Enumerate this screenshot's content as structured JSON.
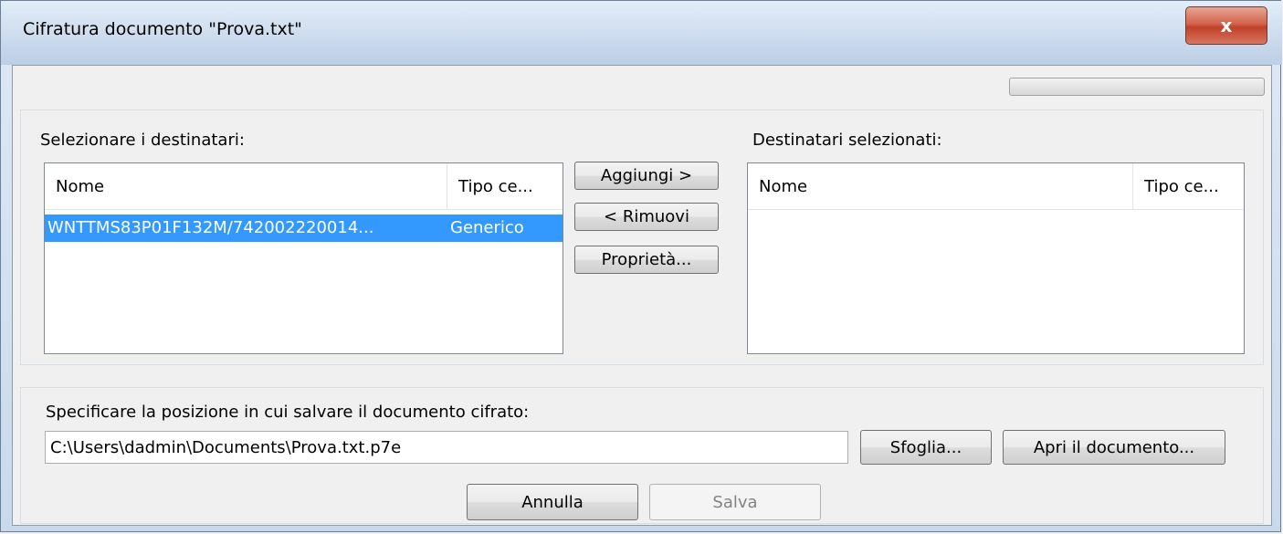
{
  "window": {
    "title": "Cifratura documento \"Prova.txt\"",
    "close_label": "x"
  },
  "recipients": {
    "label": "Selezionare i destinatari:",
    "columns": [
      "Nome",
      "Tipo ce..."
    ],
    "rows": [
      {
        "name": "WNTTMS83P01F132M/742002220014...",
        "type": "Generico",
        "selected": true
      }
    ]
  },
  "selected": {
    "label": "Destinatari selezionati:",
    "columns": [
      "Nome",
      "Tipo ce..."
    ]
  },
  "actions": {
    "add": "Aggiungi >",
    "remove": "< Rimuovi",
    "properties": "Proprietà..."
  },
  "save_location": {
    "label": "Specificare la posizione in cui salvare il documento cifrato:",
    "path": "C:\\Users\\dadmin\\Documents\\Prova.txt.p7e",
    "browse": "Sfoglia...",
    "open": "Apri il documento..."
  },
  "footer": {
    "cancel": "Annulla",
    "save": "Salva"
  },
  "colors": {
    "selection": "#3399ff",
    "close_button": "#c9452c"
  },
  "progress": {
    "value": 0
  }
}
